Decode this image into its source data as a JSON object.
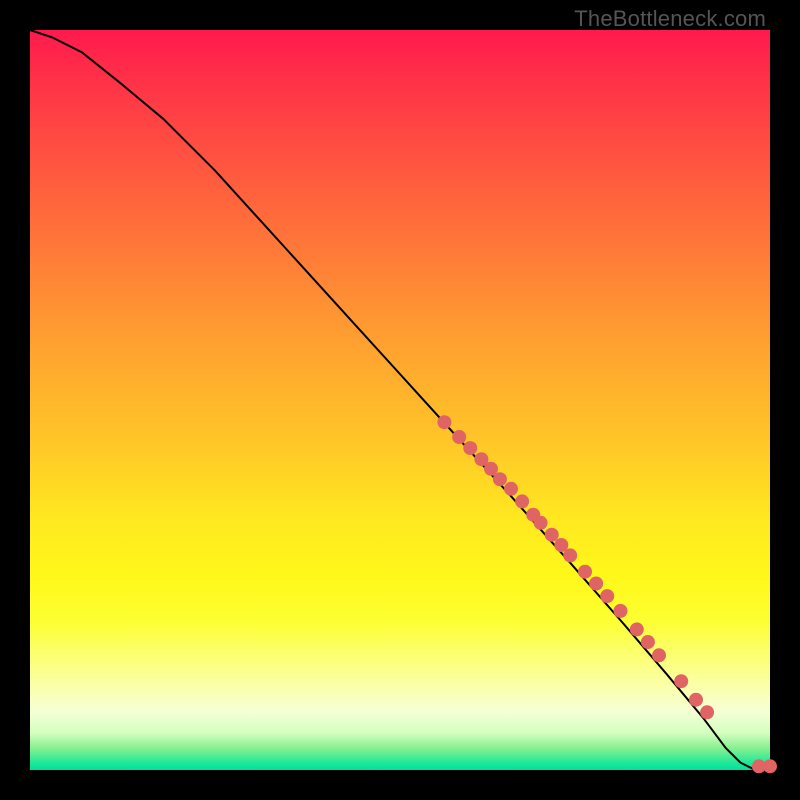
{
  "attribution": "TheBottleneck.com",
  "chart_data": {
    "type": "line",
    "title": "",
    "xlabel": "",
    "ylabel": "",
    "xlim": [
      0,
      100
    ],
    "ylim": [
      0,
      100
    ],
    "grid": false,
    "legend": null,
    "background_gradient": {
      "description": "vertical gradient red→orange→yellow→pale→green representing bottleneck severity",
      "stops": [
        {
          "pos": 0.0,
          "color": "#ff1a4d"
        },
        {
          "pos": 0.3,
          "color": "#ff7a38"
        },
        {
          "pos": 0.66,
          "color": "#ffe820"
        },
        {
          "pos": 0.88,
          "color": "#fbffa0"
        },
        {
          "pos": 0.97,
          "color": "#8af090"
        },
        {
          "pos": 1.0,
          "color": "#00e0a0"
        }
      ]
    },
    "series": [
      {
        "name": "curve",
        "type": "line",
        "color": "#000000",
        "x": [
          0,
          3,
          7,
          12,
          18,
          25,
          35,
          45,
          55,
          65,
          73,
          80,
          86,
          91,
          94,
          96,
          98,
          100
        ],
        "y": [
          100,
          99,
          97,
          93,
          88,
          81,
          70,
          59,
          48,
          37,
          28,
          20,
          13,
          7,
          3,
          1,
          0,
          0
        ]
      },
      {
        "name": "points-cluster",
        "type": "scatter",
        "color": "#e06464",
        "marker_radius": 7,
        "x": [
          56,
          58,
          59.5,
          61,
          62.3,
          63.5,
          65,
          66.5,
          68,
          69,
          70.5,
          71.8,
          73,
          75,
          76.5,
          78,
          79.8,
          82,
          83.5,
          85,
          88,
          90,
          91.5,
          98.5,
          100
        ],
        "y": [
          47,
          45,
          43.5,
          42,
          40.7,
          39.3,
          38,
          36.3,
          34.5,
          33.4,
          31.8,
          30.4,
          29,
          26.8,
          25.2,
          23.5,
          21.5,
          19,
          17.3,
          15.5,
          12,
          9.5,
          7.8,
          0.5,
          0.5
        ]
      }
    ]
  }
}
